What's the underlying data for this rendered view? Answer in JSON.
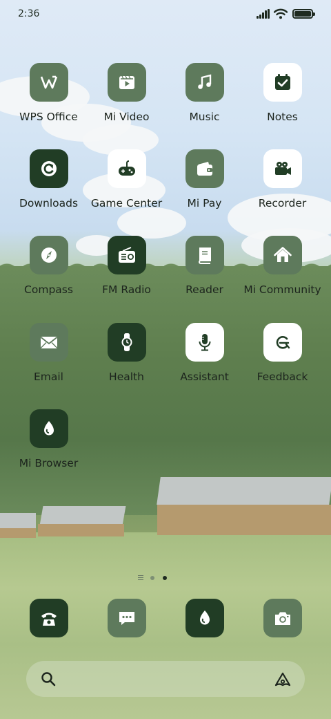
{
  "status_bar": {
    "time": "2:36",
    "battery_level": 1.0
  },
  "apps": [
    {
      "id": "wps-office",
      "label": "WPS Office",
      "icon": "wps-icon",
      "style": "mid"
    },
    {
      "id": "mi-video",
      "label": "Mi Video",
      "icon": "video-icon",
      "style": "mid"
    },
    {
      "id": "music",
      "label": "Music",
      "icon": "music-note-icon",
      "style": "mid"
    },
    {
      "id": "notes",
      "label": "Notes",
      "icon": "notes-check-icon",
      "style": "light"
    },
    {
      "id": "downloads",
      "label": "Downloads",
      "icon": "download-arrow-icon",
      "style": "dark"
    },
    {
      "id": "game-center",
      "label": "Game Center",
      "icon": "gamepad-icon",
      "style": "light"
    },
    {
      "id": "mi-pay",
      "label": "Mi Pay",
      "icon": "wallet-icon",
      "style": "mid"
    },
    {
      "id": "recorder",
      "label": "Recorder",
      "icon": "camera-recorder-icon",
      "style": "light"
    },
    {
      "id": "compass",
      "label": "Compass",
      "icon": "compass-icon",
      "style": "mid"
    },
    {
      "id": "fm-radio",
      "label": "FM Radio",
      "icon": "radio-icon",
      "style": "dark"
    },
    {
      "id": "reader",
      "label": "Reader",
      "icon": "book-icon",
      "style": "mid"
    },
    {
      "id": "mi-community",
      "label": "Mi Community",
      "icon": "home-icon",
      "style": "mid"
    },
    {
      "id": "email",
      "label": "Email",
      "icon": "envelope-icon",
      "style": "mid"
    },
    {
      "id": "health",
      "label": "Health",
      "icon": "watch-icon",
      "style": "dark"
    },
    {
      "id": "assistant",
      "label": "Assistant",
      "icon": "microphone-icon",
      "style": "light"
    },
    {
      "id": "feedback",
      "label": "Feedback",
      "icon": "feedback-icon",
      "style": "light"
    },
    {
      "id": "mi-browser",
      "label": "Mi Browser",
      "icon": "browser-drop-icon",
      "style": "dark"
    }
  ],
  "page_indicator": {
    "pages": 2,
    "current": 2
  },
  "dock": [
    {
      "id": "phone",
      "icon": "phone-icon",
      "style": "dark"
    },
    {
      "id": "messages",
      "icon": "message-icon",
      "style": "mid"
    },
    {
      "id": "browser",
      "icon": "browser-drop-icon",
      "style": "dark"
    },
    {
      "id": "camera",
      "icon": "camera-icon",
      "style": "mid"
    }
  ],
  "search_bar": {
    "left_icon": "search-icon",
    "right_icon": "assistant-a-icon"
  },
  "colors": {
    "tile_mid": "#5e7a5c",
    "tile_dark": "#213d25",
    "tile_light": "#ffffff",
    "label_text": "#1c241d"
  }
}
